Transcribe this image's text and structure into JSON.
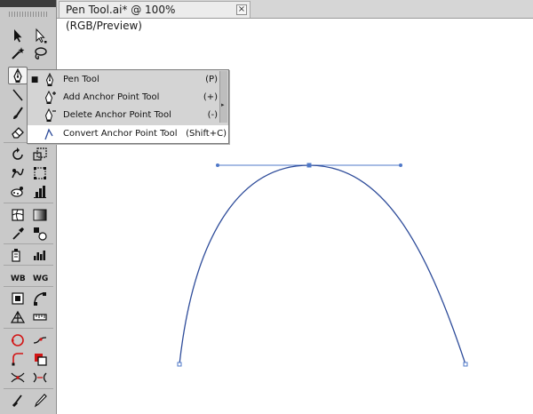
{
  "document_tab": {
    "title": "Pen Tool.ai* @ 100% (RGB/Preview)",
    "close_symbol": "×"
  },
  "tools": [
    "selection-tool",
    "direct-selection-tool",
    "magic-wand-tool",
    "lasso-tool",
    "pen-tool",
    "type-tool",
    "line-tool",
    "rectangle-tool",
    "paintbrush-tool",
    "pencil-tool",
    "eraser-tool",
    "rotate-tool",
    "scale-tool",
    "warp-tool",
    "free-transform-tool",
    "symbol-sprayer-tool",
    "graph-tool",
    "mesh-tool",
    "gradient-tool",
    "eyedropper-tool",
    "blend-tool",
    "live-paint-bucket-tool",
    "column-graph-tool",
    "artboard-tool",
    "slice-tool",
    "perspective-grid-tool",
    "measure-tool",
    "shape-builder-tool",
    "width-tool",
    "reshape-tool",
    "fill-stroke-tool",
    "join-tool",
    "split-tool",
    "scissors-tool",
    "knife-tool"
  ],
  "pen_flyout": {
    "items": [
      {
        "label": "Pen Tool",
        "shortcut": "(P)",
        "selected_marker": "■",
        "icon": "pen-icon"
      },
      {
        "label": "Add Anchor Point Tool",
        "shortcut": "(+)",
        "selected_marker": "",
        "icon": "add-anchor-point-icon"
      },
      {
        "label": "Delete Anchor Point Tool",
        "shortcut": "(-)",
        "selected_marker": "",
        "icon": "delete-anchor-point-icon"
      },
      {
        "label": "Convert Anchor Point Tool",
        "shortcut": "(Shift+C)",
        "selected_marker": "",
        "icon": "convert-anchor-point-icon"
      }
    ],
    "tearoff_symbol": "▸"
  },
  "colors": {
    "path_stroke": "#2e4c9a",
    "handle_stroke": "#4f78c8",
    "panel_bg": "#c9c9c9"
  }
}
